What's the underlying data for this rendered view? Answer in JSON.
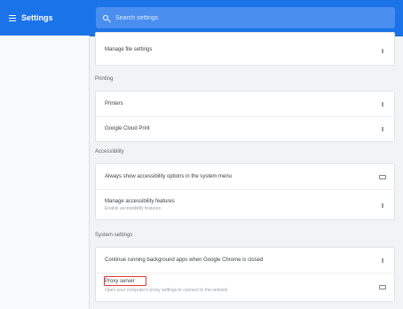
{
  "header": {
    "title": "Settings",
    "search_placeholder": "Search settings"
  },
  "sections": {
    "top": {
      "row_label": "Manage file settings"
    },
    "printing": {
      "title": "Printing",
      "rows": [
        "Printers",
        "Google Cloud Print"
      ]
    },
    "accessibility": {
      "title": "Accessibility",
      "rows": [
        {
          "label": "Always show accessibility options in the system menu"
        },
        {
          "label": "Manage accessibility features",
          "sub": "Enable accessibility features"
        }
      ]
    },
    "system": {
      "title": "System settings",
      "rows": [
        {
          "label": "Continue running background apps when Google Chrome is closed"
        },
        {
          "label": "Proxy server",
          "sub": "Open your computer's proxy settings to connect to the network"
        }
      ]
    }
  },
  "colors": {
    "header": "#1a73e8",
    "highlight": "#e53935"
  }
}
